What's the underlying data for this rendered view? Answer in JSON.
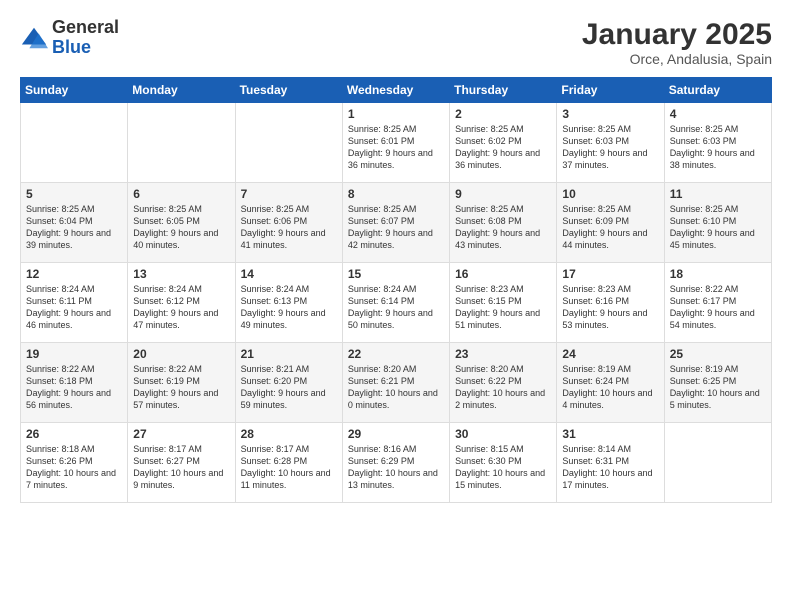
{
  "header": {
    "logo_general": "General",
    "logo_blue": "Blue",
    "title": "January 2025",
    "subtitle": "Orce, Andalusia, Spain"
  },
  "calendar": {
    "days_of_week": [
      "Sunday",
      "Monday",
      "Tuesday",
      "Wednesday",
      "Thursday",
      "Friday",
      "Saturday"
    ],
    "weeks": [
      [
        {
          "day": "",
          "sunrise": "",
          "sunset": "",
          "daylight": ""
        },
        {
          "day": "",
          "sunrise": "",
          "sunset": "",
          "daylight": ""
        },
        {
          "day": "",
          "sunrise": "",
          "sunset": "",
          "daylight": ""
        },
        {
          "day": "1",
          "sunrise": "Sunrise: 8:25 AM",
          "sunset": "Sunset: 6:01 PM",
          "daylight": "Daylight: 9 hours and 36 minutes."
        },
        {
          "day": "2",
          "sunrise": "Sunrise: 8:25 AM",
          "sunset": "Sunset: 6:02 PM",
          "daylight": "Daylight: 9 hours and 36 minutes."
        },
        {
          "day": "3",
          "sunrise": "Sunrise: 8:25 AM",
          "sunset": "Sunset: 6:03 PM",
          "daylight": "Daylight: 9 hours and 37 minutes."
        },
        {
          "day": "4",
          "sunrise": "Sunrise: 8:25 AM",
          "sunset": "Sunset: 6:03 PM",
          "daylight": "Daylight: 9 hours and 38 minutes."
        }
      ],
      [
        {
          "day": "5",
          "sunrise": "Sunrise: 8:25 AM",
          "sunset": "Sunset: 6:04 PM",
          "daylight": "Daylight: 9 hours and 39 minutes."
        },
        {
          "day": "6",
          "sunrise": "Sunrise: 8:25 AM",
          "sunset": "Sunset: 6:05 PM",
          "daylight": "Daylight: 9 hours and 40 minutes."
        },
        {
          "day": "7",
          "sunrise": "Sunrise: 8:25 AM",
          "sunset": "Sunset: 6:06 PM",
          "daylight": "Daylight: 9 hours and 41 minutes."
        },
        {
          "day": "8",
          "sunrise": "Sunrise: 8:25 AM",
          "sunset": "Sunset: 6:07 PM",
          "daylight": "Daylight: 9 hours and 42 minutes."
        },
        {
          "day": "9",
          "sunrise": "Sunrise: 8:25 AM",
          "sunset": "Sunset: 6:08 PM",
          "daylight": "Daylight: 9 hours and 43 minutes."
        },
        {
          "day": "10",
          "sunrise": "Sunrise: 8:25 AM",
          "sunset": "Sunset: 6:09 PM",
          "daylight": "Daylight: 9 hours and 44 minutes."
        },
        {
          "day": "11",
          "sunrise": "Sunrise: 8:25 AM",
          "sunset": "Sunset: 6:10 PM",
          "daylight": "Daylight: 9 hours and 45 minutes."
        }
      ],
      [
        {
          "day": "12",
          "sunrise": "Sunrise: 8:24 AM",
          "sunset": "Sunset: 6:11 PM",
          "daylight": "Daylight: 9 hours and 46 minutes."
        },
        {
          "day": "13",
          "sunrise": "Sunrise: 8:24 AM",
          "sunset": "Sunset: 6:12 PM",
          "daylight": "Daylight: 9 hours and 47 minutes."
        },
        {
          "day": "14",
          "sunrise": "Sunrise: 8:24 AM",
          "sunset": "Sunset: 6:13 PM",
          "daylight": "Daylight: 9 hours and 49 minutes."
        },
        {
          "day": "15",
          "sunrise": "Sunrise: 8:24 AM",
          "sunset": "Sunset: 6:14 PM",
          "daylight": "Daylight: 9 hours and 50 minutes."
        },
        {
          "day": "16",
          "sunrise": "Sunrise: 8:23 AM",
          "sunset": "Sunset: 6:15 PM",
          "daylight": "Daylight: 9 hours and 51 minutes."
        },
        {
          "day": "17",
          "sunrise": "Sunrise: 8:23 AM",
          "sunset": "Sunset: 6:16 PM",
          "daylight": "Daylight: 9 hours and 53 minutes."
        },
        {
          "day": "18",
          "sunrise": "Sunrise: 8:22 AM",
          "sunset": "Sunset: 6:17 PM",
          "daylight": "Daylight: 9 hours and 54 minutes."
        }
      ],
      [
        {
          "day": "19",
          "sunrise": "Sunrise: 8:22 AM",
          "sunset": "Sunset: 6:18 PM",
          "daylight": "Daylight: 9 hours and 56 minutes."
        },
        {
          "day": "20",
          "sunrise": "Sunrise: 8:22 AM",
          "sunset": "Sunset: 6:19 PM",
          "daylight": "Daylight: 9 hours and 57 minutes."
        },
        {
          "day": "21",
          "sunrise": "Sunrise: 8:21 AM",
          "sunset": "Sunset: 6:20 PM",
          "daylight": "Daylight: 9 hours and 59 minutes."
        },
        {
          "day": "22",
          "sunrise": "Sunrise: 8:20 AM",
          "sunset": "Sunset: 6:21 PM",
          "daylight": "Daylight: 10 hours and 0 minutes."
        },
        {
          "day": "23",
          "sunrise": "Sunrise: 8:20 AM",
          "sunset": "Sunset: 6:22 PM",
          "daylight": "Daylight: 10 hours and 2 minutes."
        },
        {
          "day": "24",
          "sunrise": "Sunrise: 8:19 AM",
          "sunset": "Sunset: 6:24 PM",
          "daylight": "Daylight: 10 hours and 4 minutes."
        },
        {
          "day": "25",
          "sunrise": "Sunrise: 8:19 AM",
          "sunset": "Sunset: 6:25 PM",
          "daylight": "Daylight: 10 hours and 5 minutes."
        }
      ],
      [
        {
          "day": "26",
          "sunrise": "Sunrise: 8:18 AM",
          "sunset": "Sunset: 6:26 PM",
          "daylight": "Daylight: 10 hours and 7 minutes."
        },
        {
          "day": "27",
          "sunrise": "Sunrise: 8:17 AM",
          "sunset": "Sunset: 6:27 PM",
          "daylight": "Daylight: 10 hours and 9 minutes."
        },
        {
          "day": "28",
          "sunrise": "Sunrise: 8:17 AM",
          "sunset": "Sunset: 6:28 PM",
          "daylight": "Daylight: 10 hours and 11 minutes."
        },
        {
          "day": "29",
          "sunrise": "Sunrise: 8:16 AM",
          "sunset": "Sunset: 6:29 PM",
          "daylight": "Daylight: 10 hours and 13 minutes."
        },
        {
          "day": "30",
          "sunrise": "Sunrise: 8:15 AM",
          "sunset": "Sunset: 6:30 PM",
          "daylight": "Daylight: 10 hours and 15 minutes."
        },
        {
          "day": "31",
          "sunrise": "Sunrise: 8:14 AM",
          "sunset": "Sunset: 6:31 PM",
          "daylight": "Daylight: 10 hours and 17 minutes."
        },
        {
          "day": "",
          "sunrise": "",
          "sunset": "",
          "daylight": ""
        }
      ]
    ]
  }
}
